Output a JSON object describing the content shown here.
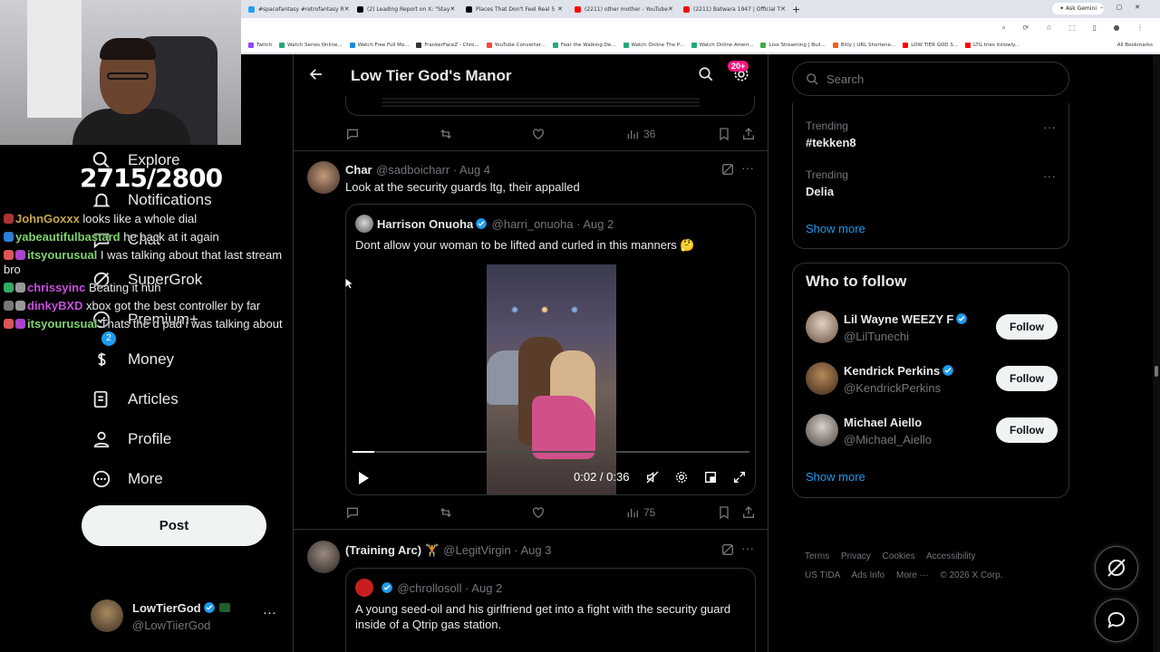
{
  "browser": {
    "tabs": [
      {
        "label": "#spacefantasy #retrofantasy R",
        "color": "#1da1f2"
      },
      {
        "label": "(2) Leading Report on X: \"Stay",
        "color": "#000000"
      },
      {
        "label": "Places That Don't Feel Real 5",
        "color": "#000000"
      },
      {
        "label": "(2211) other mother - YouTube",
        "color": "#ff0000"
      },
      {
        "label": "(2211) Batwara 1947 | Official T",
        "color": "#ff0000"
      }
    ],
    "new_tab": "+",
    "ask_gemini": "Ask Gemini",
    "bookmarks": [
      {
        "label": "Twitch",
        "color": "#9146ff"
      },
      {
        "label": "Watch Series Online...",
        "color": "#2a7"
      },
      {
        "label": "Watch Free Full Mo...",
        "color": "#1e88e5"
      },
      {
        "label": "FrankerFaceZ - Chro...",
        "color": "#333"
      },
      {
        "label": "YouTube Converter...",
        "color": "#f44"
      },
      {
        "label": "Fear the Walking De...",
        "color": "#2a7"
      },
      {
        "label": "Watch Online The P...",
        "color": "#2a7"
      },
      {
        "label": "Watch Online Ameri...",
        "color": "#2a7"
      },
      {
        "label": "Live Streaming | Buil...",
        "color": "#4a4"
      },
      {
        "label": "Bitly | URL Shortene...",
        "color": "#ee6123"
      },
      {
        "label": "LOW TIER GOD S...",
        "color": "#f00"
      },
      {
        "label": "LTG tries itslowly...",
        "color": "#f00"
      }
    ],
    "all_bookmarks": "All Bookmarks"
  },
  "stream": {
    "counter": "2715/2800",
    "chat": [
      {
        "user": "JohnGoxxx",
        "color": "#c7a54a",
        "msg": "looks like a whole dial"
      },
      {
        "user": "yabeautifulbastard",
        "color": "#7fd36d",
        "msg": "he back at it again"
      },
      {
        "user": "itsyourusual",
        "color": "#7fd36d",
        "msg": "I was talking about that last stream bro"
      },
      {
        "user": "chrissyinc",
        "color": "#c94ee0",
        "msg": "Beating it huh"
      },
      {
        "user": "dinkyBXD",
        "color": "#c94ee0",
        "msg": "xbox got the best controller by far"
      },
      {
        "user": "itsyourusual",
        "color": "#7fd36d",
        "msg": "Thats the d pad i was talking about"
      }
    ]
  },
  "nav": {
    "items": [
      {
        "label": "Explore",
        "icon": "search-icon"
      },
      {
        "label": "Notifications",
        "icon": "bell-icon"
      },
      {
        "label": "Chat",
        "icon": "chat-icon"
      },
      {
        "label": "SuperGrok",
        "icon": "grok-icon"
      },
      {
        "label": "Premium+",
        "icon": "premium-icon"
      },
      {
        "label": "Money",
        "icon": "money-icon"
      },
      {
        "label": "Articles",
        "icon": "articles-icon"
      },
      {
        "label": "Profile",
        "icon": "profile-icon"
      },
      {
        "label": "More",
        "icon": "more-icon"
      }
    ],
    "notif_count": "2",
    "post_label": "Post",
    "account": {
      "name": "LowTierGod",
      "handle": "@LowTiierGod"
    }
  },
  "main": {
    "title": "Low Tier God's Manor",
    "badge": "20+",
    "first_views": "36",
    "tweets": [
      {
        "name": "Char",
        "handle": "@sadboicharr",
        "date": "Aug 4",
        "text": "Look at the security guards ltg, their appalled",
        "quote": {
          "name": "Harrison Onuoha",
          "handle": "@harri_onuoha",
          "date": "Aug 2",
          "text": "Dont allow your woman to be lifted and curled in this manners 🤔"
        },
        "video": {
          "time": "0:02 / 0:36",
          "progress": 0.055
        },
        "views": "75"
      },
      {
        "name": "(Training Arc) 🏋",
        "handle": "@LegitVirgin",
        "date": "Aug 3",
        "quote": {
          "handle": "@chrollosoll",
          "date": "Aug 2",
          "text": "A young seed-oil and his girlfriend get into a fight with the security guard inside of a Qtrip gas station."
        }
      }
    ]
  },
  "sidebar": {
    "search_placeholder": "Search",
    "trends": [
      {
        "category": "Trending",
        "name": "#tekken8"
      },
      {
        "category": "Trending",
        "name": "Delia"
      }
    ],
    "show_more": "Show more",
    "wtf_title": "Who to follow",
    "follow": [
      {
        "name": "Lil Wayne WEEZY F",
        "handle": "@LilTunechi",
        "verified": true
      },
      {
        "name": "Kendrick Perkins",
        "handle": "@KendrickPerkins",
        "verified": true
      },
      {
        "name": "Michael Aiello",
        "handle": "@Michael_Aiello",
        "verified": false
      }
    ],
    "follow_label": "Follow",
    "footer": [
      "Terms",
      "Privacy",
      "Cookies",
      "Accessibility",
      "US TIDA",
      "Ads Info",
      "More ···",
      "© 2026 X Corp."
    ]
  },
  "colors": {
    "accent": "#1d9bf0",
    "verified": "#1d9bf0",
    "pink": "#f91880"
  }
}
